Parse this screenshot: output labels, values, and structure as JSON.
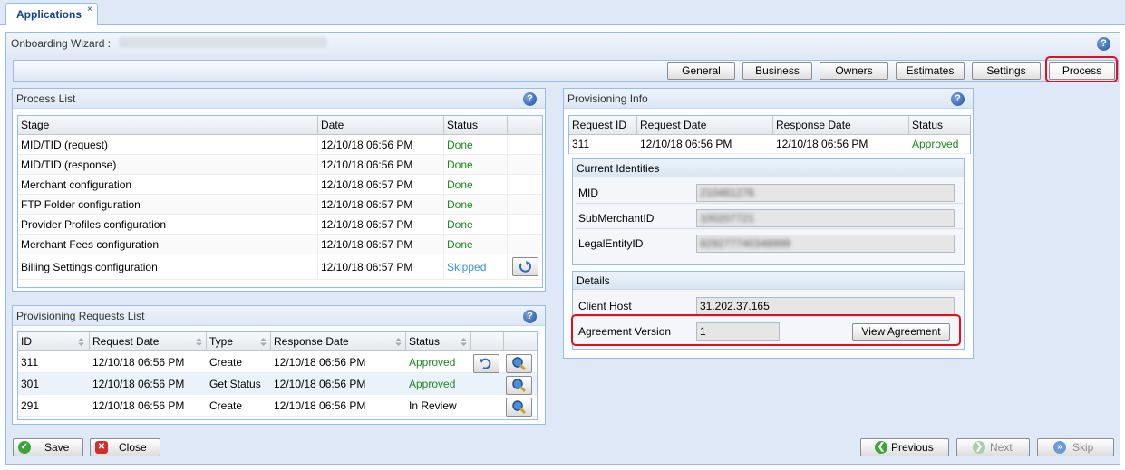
{
  "tab": {
    "label": "Applications",
    "close": "×"
  },
  "wizard": {
    "title": "Onboarding Wizard :",
    "help": "?"
  },
  "nav": [
    {
      "label": "General"
    },
    {
      "label": "Business"
    },
    {
      "label": "Owners"
    },
    {
      "label": "Estimates"
    },
    {
      "label": "Settings"
    },
    {
      "label": "Process"
    }
  ],
  "process_list": {
    "title": "Process List",
    "columns": [
      "Stage",
      "Date",
      "Status"
    ],
    "rows": [
      {
        "stage": "MID/TID (request)",
        "date": "12/10/18 06:56 PM",
        "status": "Done"
      },
      {
        "stage": "MID/TID (response)",
        "date": "12/10/18 06:56 PM",
        "status": "Done"
      },
      {
        "stage": "Merchant configuration",
        "date": "12/10/18 06:57 PM",
        "status": "Done"
      },
      {
        "stage": "FTP Folder configuration",
        "date": "12/10/18 06:57 PM",
        "status": "Done"
      },
      {
        "stage": "Provider Profiles configuration",
        "date": "12/10/18 06:57 PM",
        "status": "Done"
      },
      {
        "stage": "Merchant Fees configuration",
        "date": "12/10/18 06:57 PM",
        "status": "Done"
      },
      {
        "stage": "Billing Settings configuration",
        "date": "12/10/18 06:57 PM",
        "status": "Skipped"
      }
    ]
  },
  "requests_list": {
    "title": "Provisioning Requests List",
    "columns": [
      "ID",
      "Request Date",
      "Type",
      "Response Date",
      "Status"
    ],
    "rows": [
      {
        "id": "311",
        "request_date": "12/10/18 06:56 PM",
        "type": "Create",
        "response_date": "12/10/18 06:56 PM",
        "status": "Approved"
      },
      {
        "id": "301",
        "request_date": "12/10/18 06:56 PM",
        "type": "Get Status",
        "response_date": "12/10/18 06:56 PM",
        "status": "Approved"
      },
      {
        "id": "291",
        "request_date": "12/10/18 06:56 PM",
        "type": "Create",
        "response_date": "12/10/18 06:56 PM",
        "status": "In Review"
      }
    ]
  },
  "provisioning_info": {
    "title": "Provisioning Info",
    "columns": [
      "Request ID",
      "Request Date",
      "Response Date",
      "Status"
    ],
    "row": {
      "request_id": "311",
      "request_date": "12/10/18 06:56 PM",
      "response_date": "12/10/18 06:56 PM",
      "status": "Approved"
    },
    "identities": {
      "title": "Current Identities",
      "fields": [
        {
          "label": "MID",
          "value": "210461276"
        },
        {
          "label": "SubMerchantID",
          "value": "100207721"
        },
        {
          "label": "LegalEntityID",
          "value": "829277740348999"
        }
      ]
    },
    "details": {
      "title": "Details",
      "client_host_label": "Client Host",
      "client_host_value": "31.202.37.165",
      "agreement_label": "Agreement Version",
      "agreement_value": "1",
      "view_agreement": "View Agreement"
    }
  },
  "bottom": {
    "save": "Save",
    "close": "Close",
    "previous": "Previous",
    "next": "Next",
    "skip": "Skip"
  },
  "colors": {
    "accent": "#15428b",
    "done": "#1c8a1c",
    "skipped": "#3b8fd8",
    "highlight": "#e01020"
  }
}
